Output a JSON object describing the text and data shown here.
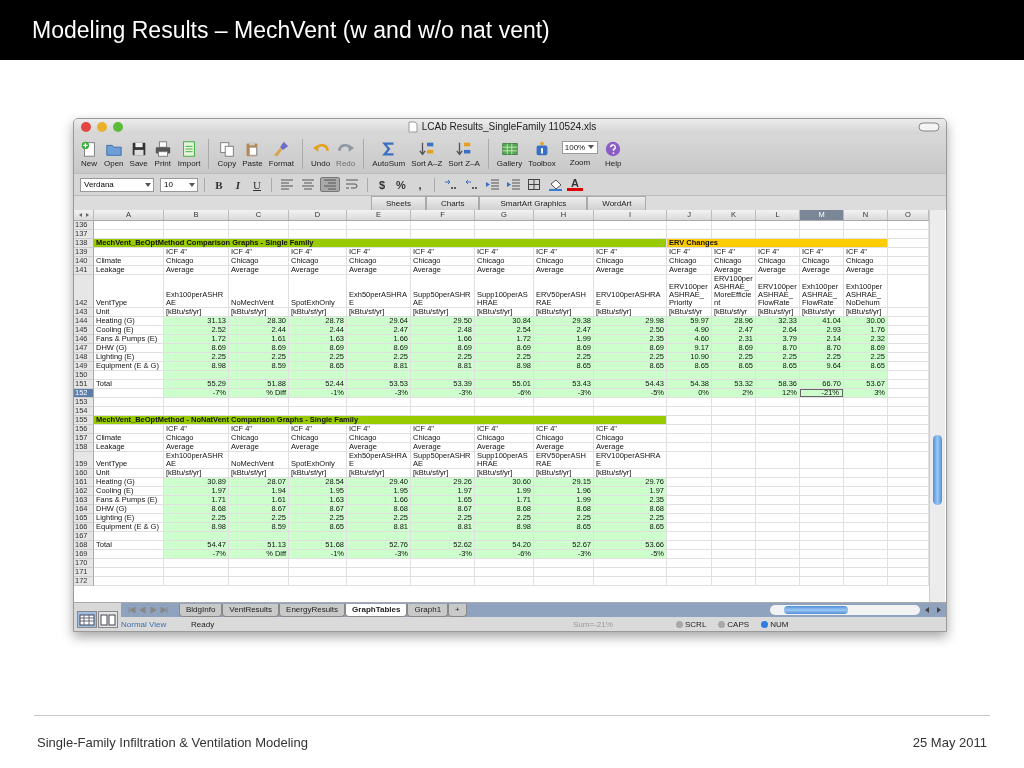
{
  "slide": {
    "title": "Modeling Results – MechVent (w and w/o nat vent)",
    "footer": "Single-Family Infiltration & Ventilation Modeling",
    "date": "25 May 2011"
  },
  "window": {
    "title": "LCAb Results_SingleFamily 110524.xls"
  },
  "toolbar": [
    {
      "kind": "button",
      "label": "New",
      "disabled": false
    },
    {
      "kind": "button",
      "label": "Open",
      "disabled": false
    },
    {
      "kind": "button",
      "label": "Save",
      "disabled": false
    },
    {
      "kind": "button",
      "label": "Print",
      "disabled": false
    },
    {
      "kind": "button",
      "label": "Import",
      "disabled": false
    },
    {
      "kind": "button",
      "label": "Copy",
      "disabled": false
    },
    {
      "kind": "button",
      "label": "Paste",
      "disabled": false
    },
    {
      "kind": "button",
      "label": "Format",
      "disabled": false
    },
    {
      "kind": "button",
      "label": "Undo",
      "disabled": false
    },
    {
      "kind": "button",
      "label": "Redo",
      "disabled": true
    },
    {
      "kind": "button",
      "label": "AutoSum",
      "disabled": false
    },
    {
      "kind": "button",
      "label": "Sort A–Z",
      "disabled": false
    },
    {
      "kind": "button",
      "label": "Sort Z–A",
      "disabled": false
    },
    {
      "kind": "button",
      "label": "Gallery",
      "disabled": false
    },
    {
      "kind": "button",
      "label": "Toolbox",
      "disabled": false
    },
    {
      "kind": "zoom",
      "label": "Zoom",
      "value": "100%",
      "disabled": false
    },
    {
      "kind": "button",
      "label": "Help",
      "disabled": false
    }
  ],
  "format_bar": {
    "font": "Verdana",
    "size": "10",
    "style_buttons": [
      "B",
      "I",
      "U"
    ],
    "align_buttons": [
      {
        "selected": false
      },
      {
        "selected": false
      },
      {
        "selected": true
      }
    ],
    "number_buttons": [
      "$",
      "%",
      ","
    ],
    "font_color": {
      "text": "A",
      "color": "#dd0000"
    }
  },
  "ribbon_tabs": [
    "Sheets",
    "Charts",
    "SmartArt Graphics",
    "WordArt"
  ],
  "grid": {
    "columns": [
      {
        "label": "A",
        "selected": false
      },
      {
        "label": "B",
        "selected": false
      },
      {
        "label": "C",
        "selected": false
      },
      {
        "label": "D",
        "selected": false
      },
      {
        "label": "E",
        "selected": false
      },
      {
        "label": "F",
        "selected": false
      },
      {
        "label": "G",
        "selected": false
      },
      {
        "label": "H",
        "selected": false
      },
      {
        "label": "I",
        "selected": false
      },
      {
        "label": "J",
        "selected": false
      },
      {
        "label": "K",
        "selected": false
      },
      {
        "label": "L",
        "selected": false
      },
      {
        "label": "M",
        "selected": true
      },
      {
        "label": "N",
        "selected": false
      },
      {
        "label": "O",
        "selected": false
      }
    ],
    "sections": [
      {
        "rows": [
          {
            "num": "136",
            "selected": false,
            "shaded": false
          },
          {
            "num": "137",
            "selected": false,
            "shaded": false
          },
          {
            "num": "138",
            "selected": false,
            "shaded": false,
            "kind": "banner",
            "segments": [
              {
                "text": "MechVent_BeOptMethod Comparison Graphs - Single Family",
                "color": "#99cc00"
              },
              {
                "text": "ERV Changes",
                "color": "#ffcc00"
              }
            ]
          },
          {
            "num": "139",
            "selected": false,
            "shaded": false,
            "kind": "text",
            "cells": [
              [
                "ICF 4\"",
                "ICF 4\"",
                "ICF 4\"",
                "ICF 4\"",
                "ICF 4\"",
                "ICF 4\"",
                "ICF 4\"",
                "ICF 4\""
              ],
              [
                "ICF 4\"",
                "ICF 4\"",
                "ICF 4\"",
                "ICF 4\"",
                "ICF 4\""
              ]
            ]
          },
          {
            "num": "140",
            "selected": false,
            "shaded": false,
            "kind": "text",
            "label": "Climate",
            "cells": [
              [
                "Chicago",
                "Chicago",
                "Chicago",
                "Chicago",
                "Chicago",
                "Chicago",
                "Chicago",
                "Chicago"
              ],
              [
                "Chicago",
                "Chicago",
                "Chicago",
                "Chicago",
                "Chicago"
              ]
            ]
          },
          {
            "num": "141",
            "selected": false,
            "shaded": false,
            "kind": "text",
            "label": "Leakage",
            "cells": [
              [
                "Average",
                "Average",
                "Average",
                "Average",
                "Average",
                "Average",
                "Average",
                "Average"
              ],
              [
                "Average",
                "Average",
                "Average",
                "Average",
                "Average"
              ]
            ]
          },
          {
            "num": "142",
            "selected": false,
            "shaded": false,
            "kind": "text",
            "label": "VentType",
            "cells": [
              [
                "Exh100perASHRAE",
                "NoMechVent",
                "SpotExhOnly",
                "Exh50perASHRAE",
                "Supp50perASHRAE",
                "Supp100perASHRAE",
                "ERV50perASHRAE",
                "ERV100perASHRAE"
              ],
              [
                "ERV100perASHRAE_Priority",
                "ERV100perASHRAE_MoreEfficient",
                "ERV100perASHRAE_FlowRate",
                "Exh100perASHRAE_FlowRate",
                "Exh100perASHRAE_NoDehum"
              ]
            ]
          },
          {
            "num": "143",
            "selected": false,
            "shaded": false,
            "kind": "text",
            "label": "Unit",
            "cells": [
              [
                "[kBtu/sf/yr]",
                "[kBtu/sf/yr]",
                "[kBtu/sf/yr]",
                "[kBtu/sf/yr]",
                "[kBtu/sf/yr]",
                "[kBtu/sf/yr]",
                "[kBtu/sf/yr]",
                "[kBtu/sf/yr]"
              ],
              [
                "[kBtu/sf/yr",
                "[kBtu/sf/yr",
                "[kBtu/sf/yr]",
                "[kBtu/sf/yr",
                "[kBtu/sf/yr]"
              ]
            ]
          },
          {
            "num": "144",
            "selected": false,
            "shaded": true,
            "kind": "values",
            "label": "Heating (G)",
            "cells": [
              [
                "31.13",
                "28.30",
                "28.78",
                "29.64",
                "29.50",
                "30.84",
                "29.38",
                "29.98"
              ],
              [
                "59.97",
                "28.96",
                "32.33",
                "41.04",
                "30.00"
              ]
            ]
          },
          {
            "num": "145",
            "selected": false,
            "shaded": true,
            "kind": "values",
            "label": "Cooling (E)",
            "cells": [
              [
                "2.52",
                "2.44",
                "2.44",
                "2.47",
                "2.48",
                "2.54",
                "2.47",
                "2.50"
              ],
              [
                "4.90",
                "2.47",
                "2.64",
                "2.93",
                "1.76"
              ]
            ]
          },
          {
            "num": "146",
            "selected": false,
            "shaded": true,
            "kind": "values",
            "label": "Fans & Pumps (E)",
            "cells": [
              [
                "1.72",
                "1.61",
                "1.63",
                "1.66",
                "1.66",
                "1.72",
                "1.99",
                "2.35"
              ],
              [
                "4.60",
                "2.31",
                "3.79",
                "2.14",
                "2.32"
              ]
            ]
          },
          {
            "num": "147",
            "selected": false,
            "shaded": true,
            "kind": "values",
            "label": "DHW (G)",
            "cells": [
              [
                "8.69",
                "8.69",
                "8.69",
                "8.69",
                "8.69",
                "8.69",
                "8.69",
                "8.69"
              ],
              [
                "9.17",
                "8.69",
                "8.70",
                "8.70",
                "8.69"
              ]
            ]
          },
          {
            "num": "148",
            "selected": false,
            "shaded": true,
            "kind": "values",
            "label": "Lighting (E)",
            "cells": [
              [
                "2.25",
                "2.25",
                "2.25",
                "2.25",
                "2.25",
                "2.25",
                "2.25",
                "2.25"
              ],
              [
                "10.90",
                "2.25",
                "2.25",
                "2.25",
                "2.25"
              ]
            ]
          },
          {
            "num": "149",
            "selected": false,
            "shaded": true,
            "kind": "values",
            "label": "Equipment (E & G)",
            "cells": [
              [
                "8.98",
                "8.59",
                "8.65",
                "8.81",
                "8.81",
                "8.98",
                "8.65",
                "8.65"
              ],
              [
                "8.65",
                "8.65",
                "8.65",
                "9.64",
                "8.65"
              ]
            ]
          },
          {
            "num": "150",
            "selected": false,
            "shaded": true,
            "kind": "values"
          },
          {
            "num": "151",
            "selected": false,
            "shaded": true,
            "kind": "values",
            "label": "Total",
            "cells": [
              [
                "55.29",
                "51.88",
                "52.44",
                "53.53",
                "53.39",
                "55.01",
                "53.43",
                "54.43"
              ],
              [
                "54.38",
                "53.32",
                "58.36",
                "66.70",
                "53.67"
              ]
            ]
          },
          {
            "num": "152",
            "selected": true,
            "shaded": true,
            "kind": "values",
            "cells": [
              [
                "-7%",
                "% Diff",
                "-1%",
                "-3%",
                "-3%",
                "-6%",
                "-3%",
                "-5%"
              ],
              [
                "0%",
                "2%",
                "12%",
                "-21%",
                "3%"
              ]
            ]
          },
          {
            "num": "153",
            "selected": false,
            "shaded": false
          },
          {
            "num": "154",
            "selected": false,
            "shaded": false
          }
        ]
      },
      {
        "rows": [
          {
            "num": "155",
            "selected": false,
            "shaded": false,
            "kind": "banner",
            "segments": [
              {
                "text": "MechVent_BeOptMethod - NoNatVent Comparison Graphs - Single Family",
                "color": "#99cc00"
              }
            ]
          },
          {
            "num": "156",
            "selected": false,
            "shaded": false,
            "kind": "text",
            "cells": [
              [
                "ICF 4\"",
                "ICF 4\"",
                "ICF 4\"",
                "ICF 4\"",
                "ICF 4\"",
                "ICF 4\"",
                "ICF 4\"",
                "ICF 4\""
              ]
            ]
          },
          {
            "num": "157",
            "selected": false,
            "shaded": false,
            "kind": "text",
            "label": "Climate",
            "cells": [
              [
                "Chicago",
                "Chicago",
                "Chicago",
                "Chicago",
                "Chicago",
                "Chicago",
                "Chicago",
                "Chicago"
              ]
            ]
          },
          {
            "num": "158",
            "selected": false,
            "shaded": false,
            "kind": "text",
            "label": "Leakage",
            "cells": [
              [
                "Average",
                "Average",
                "Average",
                "Average",
                "Average",
                "Average",
                "Average",
                "Average"
              ]
            ]
          },
          {
            "num": "159",
            "selected": false,
            "shaded": false,
            "kind": "text",
            "label": "VentType",
            "cells": [
              [
                "Exh100perASHRAE",
                "NoMechVent",
                "SpotExhOnly",
                "Exh50perASHRAE",
                "Supp50perASHRAE",
                "Supp100perASHRAE",
                "ERV50perASHRAE",
                "ERV100perASHRAE"
              ]
            ]
          },
          {
            "num": "160",
            "selected": false,
            "shaded": false,
            "kind": "text",
            "label": "Unit",
            "cells": [
              [
                "[kBtu/sf/yr]",
                "[kBtu/sf/yr]",
                "[kBtu/sf/yr]",
                "[kBtu/sf/yr]",
                "[kBtu/sf/yr]",
                "[kBtu/sf/yr]",
                "[kBtu/sf/yr]",
                "[kBtu/sf/yr]"
              ]
            ]
          },
          {
            "num": "161",
            "selected": false,
            "shaded": true,
            "kind": "values",
            "label": "Heating (G)",
            "cells": [
              [
                "30.89",
                "28.07",
                "28.54",
                "29.40",
                "29.26",
                "30.60",
                "29.15",
                "29.76"
              ]
            ]
          },
          {
            "num": "162",
            "selected": false,
            "shaded": true,
            "kind": "values",
            "label": "Cooling (E)",
            "cells": [
              [
                "1.97",
                "1.94",
                "1.95",
                "1.95",
                "1.97",
                "1.99",
                "1.96",
                "1.97"
              ]
            ]
          },
          {
            "num": "163",
            "selected": false,
            "shaded": true,
            "kind": "values",
            "label": "Fans & Pumps (E)",
            "cells": [
              [
                "1.71",
                "1.61",
                "1.63",
                "1.66",
                "1.65",
                "1.71",
                "1.99",
                "2.35"
              ]
            ]
          },
          {
            "num": "164",
            "selected": false,
            "shaded": true,
            "kind": "values",
            "label": "DHW (G)",
            "cells": [
              [
                "8.68",
                "8.67",
                "8.67",
                "8.68",
                "8.67",
                "8.68",
                "8.68",
                "8.68"
              ]
            ]
          },
          {
            "num": "165",
            "selected": false,
            "shaded": true,
            "kind": "values",
            "label": "Lighting (E)",
            "cells": [
              [
                "2.25",
                "2.25",
                "2.25",
                "2.25",
                "2.25",
                "2.25",
                "2.25",
                "2.25"
              ]
            ]
          },
          {
            "num": "166",
            "selected": false,
            "shaded": true,
            "kind": "values",
            "label": "Equipment (E & G)",
            "cells": [
              [
                "8.98",
                "8.59",
                "8.65",
                "8.81",
                "8.81",
                "8.98",
                "8.65",
                "8.65"
              ]
            ]
          },
          {
            "num": "167",
            "selected": false,
            "shaded": true,
            "kind": "values"
          },
          {
            "num": "168",
            "selected": false,
            "shaded": true,
            "kind": "values",
            "label": "Total",
            "cells": [
              [
                "54.47",
                "51.13",
                "51.68",
                "52.76",
                "52.62",
                "54.20",
                "52.67",
                "53.66"
              ]
            ]
          },
          {
            "num": "169",
            "selected": false,
            "shaded": true,
            "kind": "values",
            "cells": [
              [
                "-7%",
                "% Diff",
                "-1%",
                "-3%",
                "-3%",
                "-6%",
                "-3%",
                "-5%"
              ]
            ]
          },
          {
            "num": "170",
            "selected": false,
            "shaded": false
          },
          {
            "num": "171",
            "selected": false,
            "shaded": false
          },
          {
            "num": "172",
            "selected": false,
            "shaded": false
          }
        ]
      }
    ]
  },
  "sheet_tabs": [
    {
      "label": "BldgInfo",
      "selected": false
    },
    {
      "label": "VentResults",
      "selected": false
    },
    {
      "label": "EnergyResults",
      "selected": false
    },
    {
      "label": "GraphTables",
      "selected": true
    },
    {
      "label": "Graph1",
      "selected": false
    },
    {
      "label": "+",
      "selected": false
    }
  ],
  "view_buttons": [
    {
      "selected": true
    },
    {
      "selected": false
    }
  ],
  "status_bar": {
    "view": "Normal View",
    "message": "Ready",
    "sum": "Sum=-21%",
    "indicators": [
      {
        "text": "SCRL",
        "on": false
      },
      {
        "text": "CAPS",
        "on": false
      },
      {
        "text": "NUM",
        "on": true
      }
    ]
  }
}
